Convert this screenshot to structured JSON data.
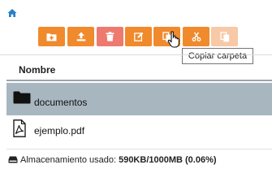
{
  "nav": {
    "home_icon": "home-icon"
  },
  "toolbar": {
    "buttons": [
      {
        "name": "new-folder",
        "icon": "folder-plus-icon",
        "color": "#f08a2c",
        "enabled": true
      },
      {
        "name": "upload",
        "icon": "upload-icon",
        "color": "#f08a2c",
        "enabled": true
      },
      {
        "name": "delete",
        "icon": "trash-icon",
        "color": "#ee7a6f",
        "enabled": true
      },
      {
        "name": "rename",
        "icon": "edit-icon",
        "color": "#f08a2c",
        "enabled": true
      },
      {
        "name": "copy-folder",
        "icon": "copy-icon",
        "color": "#f08a2c",
        "enabled": true
      },
      {
        "name": "cut",
        "icon": "scissors-icon",
        "color": "#f08a2c",
        "enabled": true
      },
      {
        "name": "paste",
        "icon": "paste-icon",
        "color": "#f7c9a6",
        "enabled": false
      }
    ],
    "tooltip": "Copiar carpeta"
  },
  "table": {
    "column_header": "Nombre",
    "rows": [
      {
        "name": "documentos",
        "icon": "folder-icon",
        "selected": true
      },
      {
        "name": "ejemplo.pdf",
        "icon": "pdf-file-icon",
        "selected": false
      }
    ]
  },
  "storage": {
    "icon": "hard-drive-icon",
    "label": "Almacenamiento usado:",
    "value": "590KB/1000MB (0.06%)"
  },
  "colors": {
    "accent": "#f08a2c",
    "danger": "#ee7a6f",
    "selected_row": "#a8b6bf",
    "home_icon": "#2a80c6"
  }
}
